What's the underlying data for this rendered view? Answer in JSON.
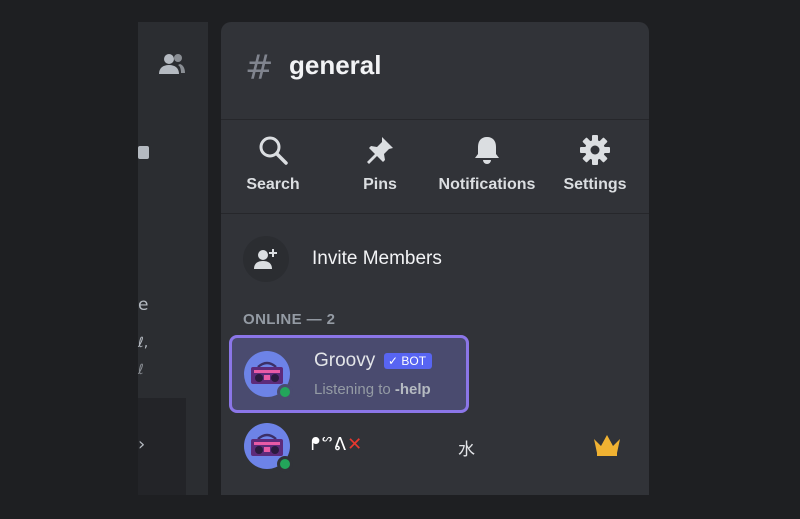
{
  "channel": {
    "hash": "#",
    "name": "general"
  },
  "actions": [
    {
      "icon": "search-icon",
      "label": "Search"
    },
    {
      "icon": "pin-icon",
      "label": "Pins"
    },
    {
      "icon": "bell-icon",
      "label": "Notifications"
    },
    {
      "icon": "gear-icon",
      "label": "Settings"
    }
  ],
  "invite": {
    "label": "Invite Members"
  },
  "section": {
    "heading": "ONLINE — 2"
  },
  "members": [
    {
      "name": "Groovy",
      "badge": "✓ BOT",
      "activity_prefix": "Listening to ",
      "activity_value": "-help",
      "status": "online",
      "selected": true
    },
    {
      "name_prefix": "ᖰᔥᕕ",
      "name_mark": "✕",
      "name_suffix": "水",
      "status": "online",
      "owner": true
    }
  ],
  "background_panel": {
    "frag_e": "e",
    "frag_comma": "ℓ,",
    "frag_comma2": "ℓ",
    "chevron": "›"
  },
  "colors": {
    "accent": "#5865f2",
    "selection": "#8b76e8",
    "online": "#23a55a",
    "crown": "#f0b232"
  }
}
